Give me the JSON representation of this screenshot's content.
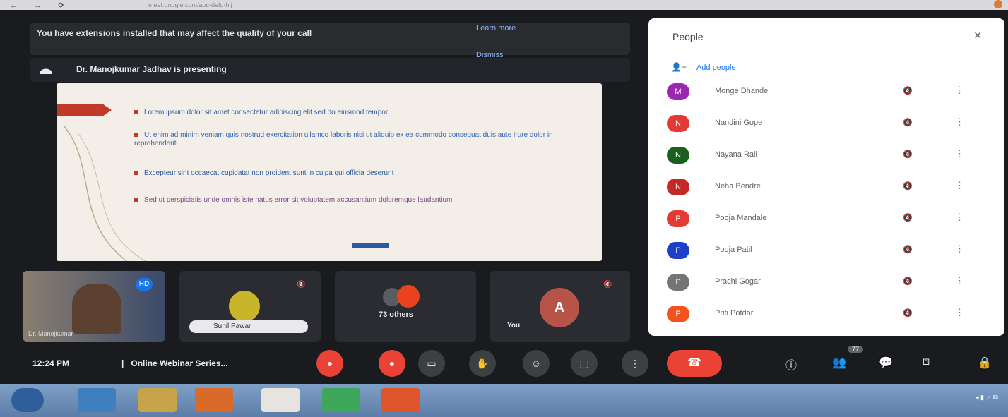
{
  "browser": {
    "url": "meet.google.com/abc-defg-hij"
  },
  "banner": {
    "message": "You have extensions installed that may affect the quality of your call",
    "learn_more": "Learn more",
    "dismiss": "Dismiss"
  },
  "presenting": {
    "text": "Dr. Manojkumar Jadhav is presenting"
  },
  "slide": {
    "bullets": [
      "Lorem ipsum dolor sit amet consectetur adipiscing elit sed do eiusmod tempor",
      "Ut enim ad minim veniam quis nostrud exercitation ullamco laboris nisi ut aliquip ex ea commodo consequat duis aute irure dolor in reprehenderit",
      "Excepteur sint occaecat cupidatat non proident sunt in culpa qui officia deserunt",
      "Sed ut perspiciatis unde omnis iste natus error sit voluptatem accusantium doloremque laudantium"
    ]
  },
  "tiles": {
    "presenter_name": "Dr. Manojkumar",
    "presenter_badge": "HD",
    "tile2_name": "Sunil Pawar",
    "others_label": "73 others",
    "you_label": "You",
    "you_initial": "A"
  },
  "people": {
    "title": "People",
    "add_people": "Add people",
    "participants": [
      {
        "initial": "M",
        "name": "Monge Dhande",
        "color": "#9c27b0"
      },
      {
        "initial": "N",
        "name": "Nandini Gope",
        "color": "#e53935"
      },
      {
        "initial": "N",
        "name": "Nayana Rail",
        "color": "#1b5e20"
      },
      {
        "initial": "N",
        "name": "Neha Bendre",
        "color": "#c62828"
      },
      {
        "initial": "P",
        "name": "Pooja Mandale",
        "color": "#e53935"
      },
      {
        "initial": "P",
        "name": "Pooja Patil",
        "color": "#1e40c8"
      },
      {
        "initial": "P",
        "name": "Prachi Gogar",
        "color": "#757575"
      },
      {
        "initial": "P",
        "name": "Priti Potdar",
        "color": "#f4511e"
      }
    ]
  },
  "controls": {
    "time": "12:24 PM",
    "separator": "|",
    "meeting_name": "Online Webinar Series...",
    "participants_count": "77"
  }
}
